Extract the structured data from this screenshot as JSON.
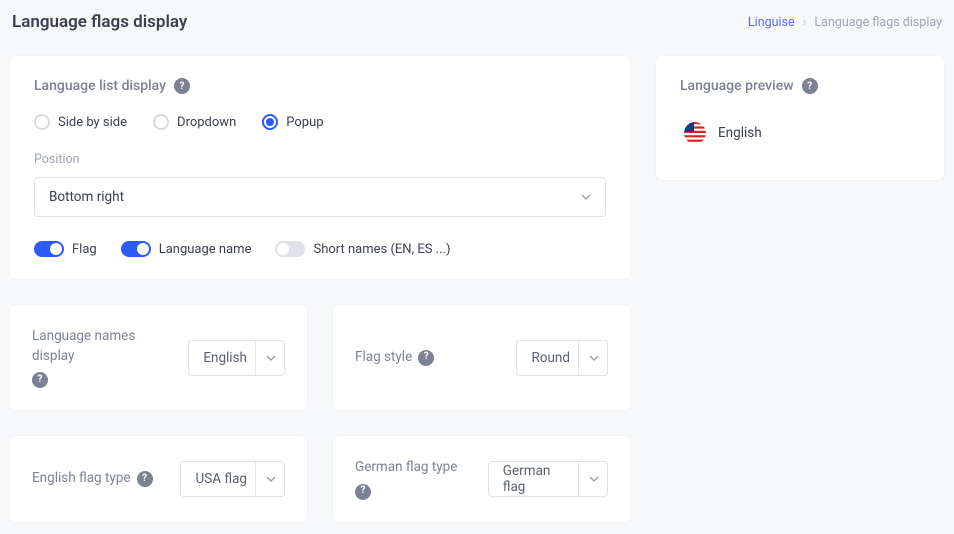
{
  "header": {
    "title": "Language flags display",
    "breadcrumb": {
      "link": "Linguise",
      "current": "Language flags display"
    }
  },
  "main": {
    "list_display": {
      "title": "Language list display",
      "options": {
        "side_by_side": "Side by side",
        "dropdown": "Dropdown",
        "popup": "Popup"
      },
      "selected": "popup",
      "position_label": "Position",
      "position_value": "Bottom right",
      "toggles": {
        "flag": {
          "label": "Flag",
          "on": true
        },
        "language_name": {
          "label": "Language name",
          "on": true
        },
        "short_names": {
          "label": "Short names (EN, ES ...)",
          "on": false
        }
      }
    },
    "names_display": {
      "label": "Language names display",
      "value": "English"
    },
    "flag_style": {
      "label": "Flag style",
      "value": "Round"
    },
    "english_flag_type": {
      "label": "English flag type",
      "value": "USA flag"
    },
    "german_flag_type": {
      "label": "German flag type",
      "value": "German flag"
    }
  },
  "preview": {
    "title": "Language preview",
    "language": "English"
  }
}
